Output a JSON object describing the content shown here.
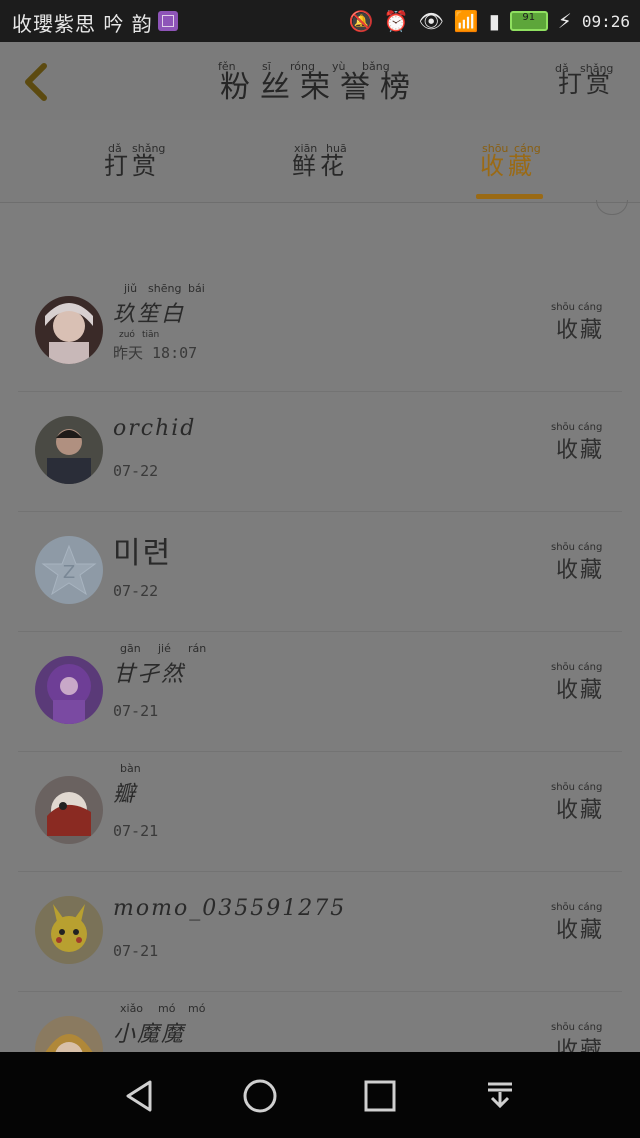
{
  "status_bar": {
    "left_text": "收瓔紫思 吟 韵",
    "time": "09:26",
    "battery_level": "91",
    "icons": [
      "gallery-icon",
      "mute-icon",
      "alarm-icon",
      "eye-icon",
      "wifi-icon",
      "sim-icon",
      "battery-icon",
      "charging-icon"
    ]
  },
  "header": {
    "title": "粉丝荣誉榜",
    "title_pinyin": [
      "fěn",
      "sī",
      "róng",
      "yù",
      "bǎng"
    ],
    "right_action": "打赏",
    "right_action_pinyin": [
      "dǎ",
      "shǎng"
    ]
  },
  "tabs": [
    {
      "label": "打赏",
      "pinyin": [
        "dǎ",
        "shǎng"
      ],
      "active": false
    },
    {
      "label": "鲜花",
      "pinyin": [
        "xiān",
        "huā"
      ],
      "active": false
    },
    {
      "label": "收藏",
      "pinyin": [
        "shōu",
        "cáng"
      ],
      "active": true
    }
  ],
  "rows": [
    {
      "name": "玖笙白",
      "name_pinyin": [
        "jiǔ",
        "shēng",
        "bái"
      ],
      "time": "昨天 18:07",
      "time_pinyin": [
        "zuó",
        "tiān"
      ],
      "action": "收藏",
      "action_pinyin": [
        "shōu",
        "cáng"
      ]
    },
    {
      "name": "orchid",
      "time": "07-22",
      "action": "收藏",
      "action_pinyin": [
        "shōu",
        "cáng"
      ]
    },
    {
      "name": "미련",
      "time": "07-22",
      "action": "收藏",
      "action_pinyin": [
        "shōu",
        "cáng"
      ]
    },
    {
      "name": "甘孑然",
      "name_pinyin": [
        "gān",
        "jié",
        "rán"
      ],
      "time": "07-21",
      "action": "收藏",
      "action_pinyin": [
        "shōu",
        "cáng"
      ]
    },
    {
      "name": "瓣",
      "name_pinyin": [
        "bàn"
      ],
      "time": "07-21",
      "action": "收藏",
      "action_pinyin": [
        "shōu",
        "cáng"
      ]
    },
    {
      "name": "momo_035591275",
      "time": "07-21",
      "action": "收藏",
      "action_pinyin": [
        "shōu",
        "cáng"
      ]
    },
    {
      "name": "小魔魔",
      "name_pinyin": [
        "xiǎo",
        "mó",
        "mó"
      ],
      "time": "",
      "action": "收藏",
      "action_pinyin": [
        "shōu",
        "cáng"
      ]
    }
  ],
  "colors": {
    "accent": "#9a6a15",
    "overlay": "#7d7d7d",
    "nav_bar": "#050505"
  }
}
